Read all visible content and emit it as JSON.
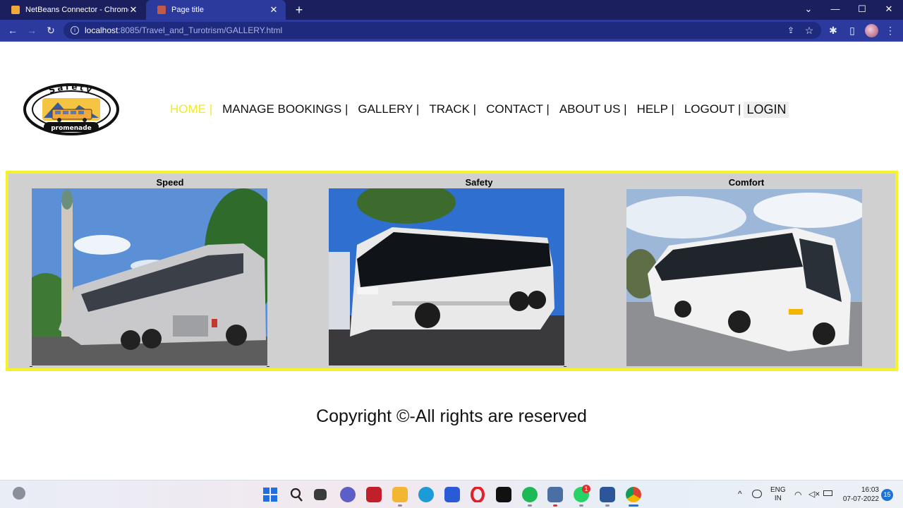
{
  "browser": {
    "tabs": [
      {
        "title": "NetBeans Connector - Chrome W",
        "close": "✕"
      },
      {
        "title": "Page title",
        "close": "✕"
      }
    ],
    "new_tab": "+",
    "window_controls": {
      "dropdown": "⌄",
      "minimize": "—",
      "maximize": "☐",
      "close": "✕"
    },
    "nav": {
      "back": "←",
      "forward": "→",
      "reload": "↻"
    },
    "address": {
      "host": "localhost",
      "path": ":8085/Travel_and_Turotrism/GALLERY.html"
    },
    "icons": {
      "share": "⇪",
      "bookmark": "☆",
      "extensions": "✱",
      "side_panel": "▯",
      "menu": "⋮"
    }
  },
  "site": {
    "logo": {
      "top_text": "Safety",
      "bottom_text": "promenade"
    },
    "nav": [
      {
        "label": "HOME |"
      },
      {
        "label": "MANAGE BOOKINGS |"
      },
      {
        "label": "GALLERY |"
      },
      {
        "label": "TRACK |"
      },
      {
        "label": "CONTACT |"
      },
      {
        "label": "ABOUT US |"
      },
      {
        "label": "HELP |"
      },
      {
        "label": "LOGOUT |"
      }
    ],
    "login": "LOGIN",
    "gallery": [
      {
        "title": "Speed"
      },
      {
        "title": "Safety"
      },
      {
        "title": "Comfort"
      }
    ],
    "copyright": "Copyright ©-All rights are reserved"
  },
  "taskbar": {
    "whatsapp_badge": "1",
    "language": {
      "line1": "ENG",
      "line2": "IN"
    },
    "time": "16:03",
    "date": "07-07-2022",
    "notifications": "15"
  },
  "colors": {
    "tabbar": "#1b1f5e",
    "toolbar": "#2c3a9e",
    "nav_active": "#f0ea2c",
    "gallery_border": "#f5f12a",
    "gallery_bg": "#d0d0d0"
  }
}
